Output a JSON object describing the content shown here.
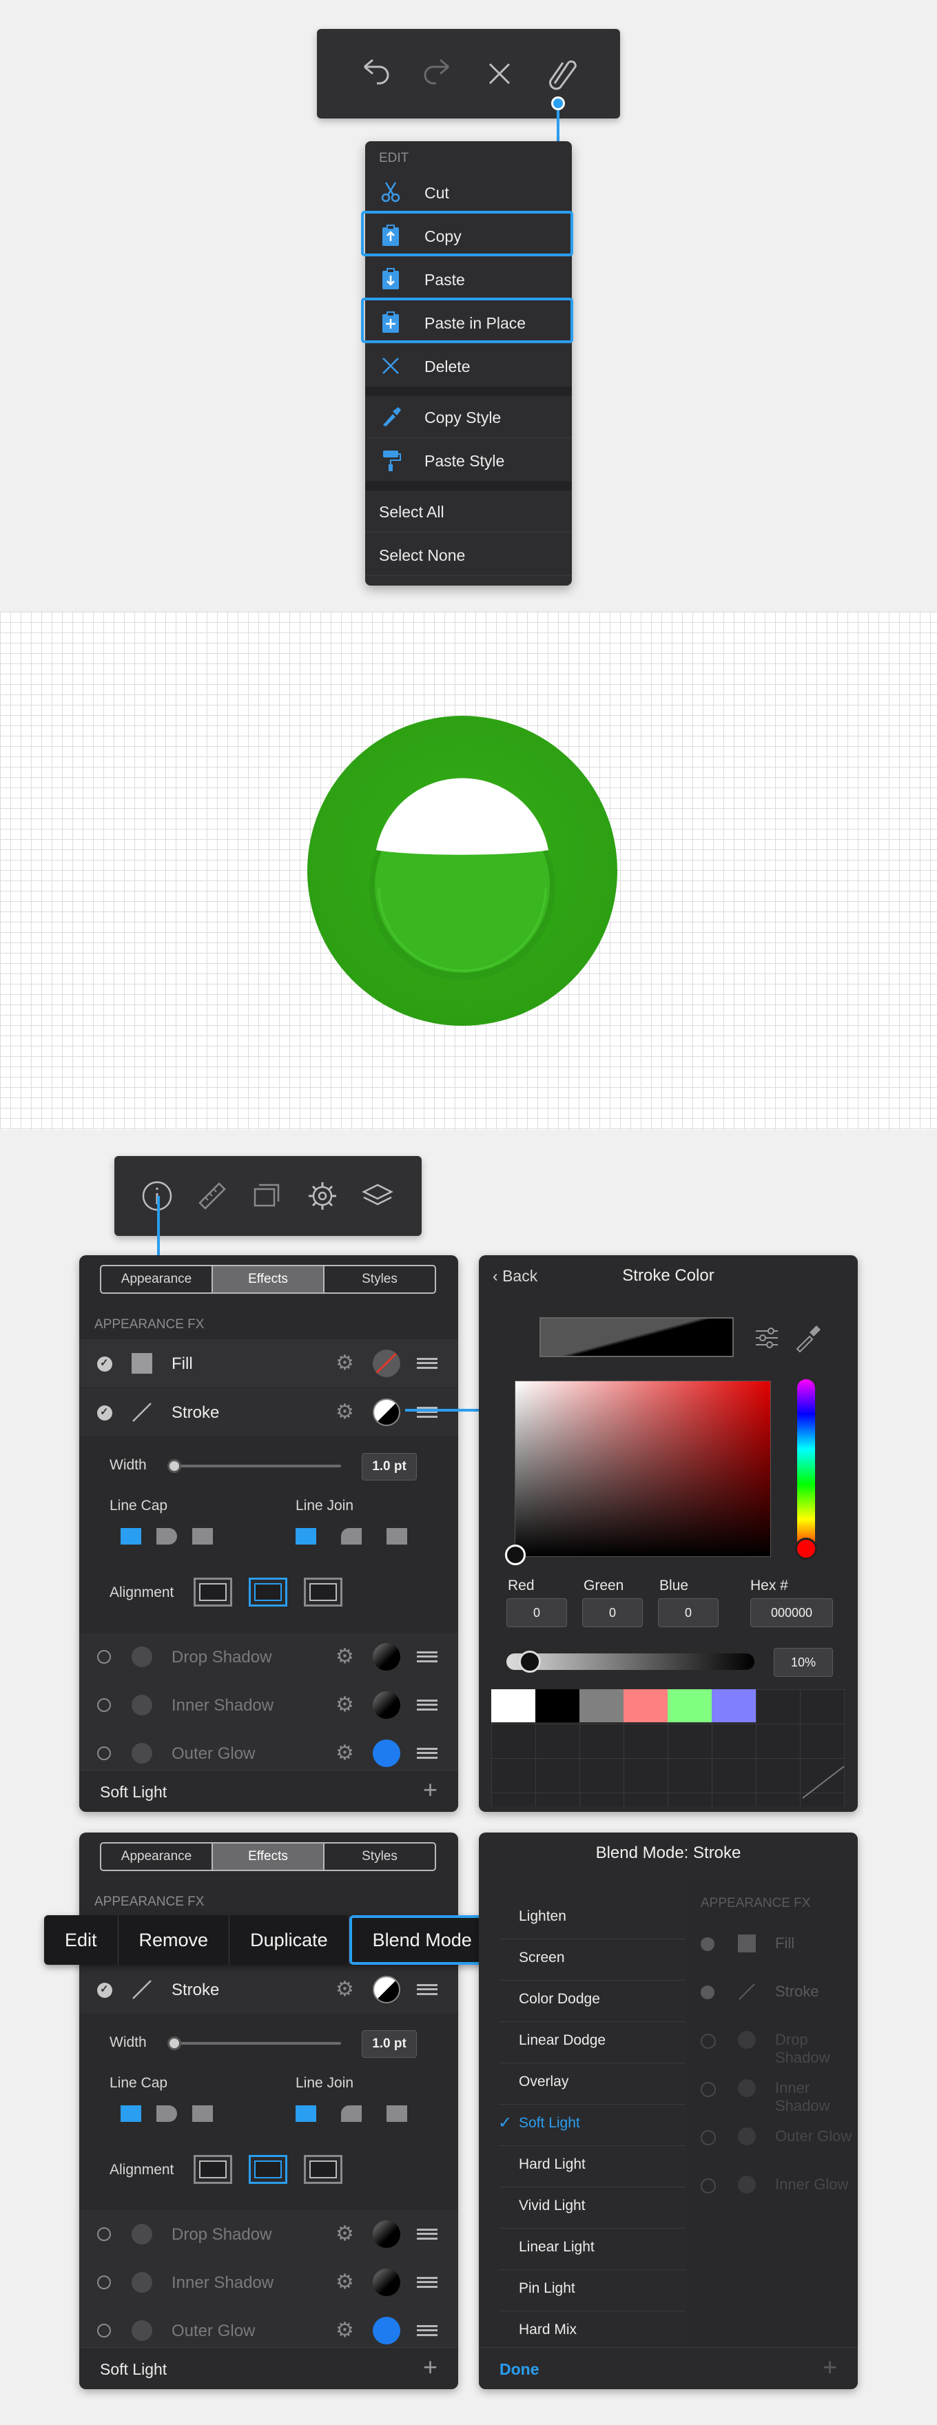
{
  "toolbar_top": {
    "icons": [
      "undo-icon",
      "redo-icon",
      "close-icon",
      "paperclip-icon"
    ]
  },
  "edit_menu": {
    "heading": "EDIT",
    "items": [
      {
        "label": "Cut",
        "icon": "scissors-icon"
      },
      {
        "label": "Copy",
        "icon": "clipboard-copy-icon",
        "highlighted": true
      },
      {
        "label": "Paste",
        "icon": "clipboard-paste-icon"
      },
      {
        "label": "Paste in Place",
        "icon": "clipboard-paste-in-place-icon",
        "highlighted": true
      },
      {
        "label": "Delete",
        "icon": "delete-x-icon"
      },
      {
        "label": "Copy Style",
        "icon": "eyedropper-icon"
      },
      {
        "label": "Paste Style",
        "icon": "paint-roller-icon"
      },
      {
        "label": "Select All"
      },
      {
        "label": "Select None"
      }
    ]
  },
  "canvas": {
    "shape_color": "#2fa515",
    "inner_color": "#36b41e",
    "highlight": "#ffffff"
  },
  "toolbar_mid": {
    "icons": [
      "info-icon",
      "ruler-icon",
      "artboards-icon",
      "gear-icon",
      "layers-icon"
    ]
  },
  "appearance_panel": {
    "tabs": [
      "Appearance",
      "Effects",
      "Styles"
    ],
    "active_tab": "Effects",
    "section": "APPEARANCE FX",
    "fill_label": "Fill",
    "stroke_label": "Stroke",
    "width_label": "Width",
    "width_value": "1.0 pt",
    "line_cap_label": "Line Cap",
    "line_join_label": "Line Join",
    "alignment_label": "Alignment",
    "effects": [
      "Drop Shadow",
      "Inner Shadow",
      "Outer Glow"
    ],
    "footer": "Soft Light"
  },
  "stroke_color_panel": {
    "back_label": "Back",
    "title": "Stroke Color",
    "red_label": "Red",
    "red": "0",
    "green_label": "Green",
    "green": "0",
    "blue_label": "Blue",
    "blue": "0",
    "hex_label": "Hex #",
    "hex": "000000",
    "opacity": "10%",
    "swatches": [
      "#ffffff",
      "#000000",
      "#808080",
      "#ff8080",
      "#80ff80",
      "#8080ff"
    ]
  },
  "context_menu": {
    "items": [
      "Edit",
      "Remove",
      "Duplicate",
      "Blend Mode"
    ],
    "highlighted": "Blend Mode"
  },
  "blend_panel": {
    "title": "Blend Mode: Stroke",
    "modes": [
      "Lighten",
      "Screen",
      "Color Dodge",
      "Linear Dodge",
      "Overlay",
      "Soft Light",
      "Hard Light",
      "Vivid Light",
      "Linear Light",
      "Pin Light",
      "Hard Mix"
    ],
    "selected": "Soft Light",
    "done_label": "Done",
    "bg_section": "APPEARANCE FX",
    "bg_items": [
      "Fill",
      "Stroke",
      "Drop Shadow",
      "Inner Shadow",
      "Outer Glow",
      "Inner Glow"
    ]
  }
}
